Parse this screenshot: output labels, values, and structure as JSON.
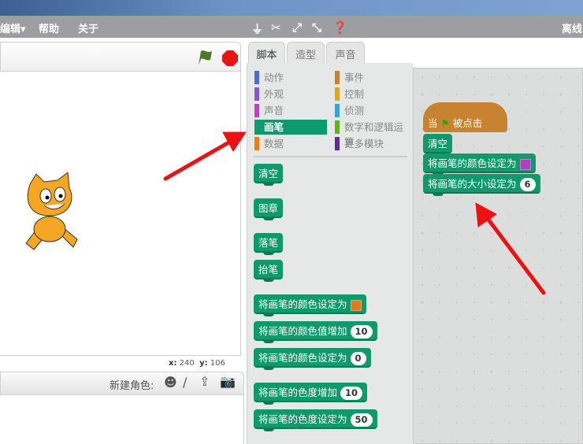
{
  "menu": {
    "edit": "编辑▾",
    "help": "帮助",
    "about": "关于",
    "offline": "离线"
  },
  "toolbar": [
    "stamp-icon",
    "scissors-icon",
    "grow-icon",
    "shrink-icon",
    "help-icon"
  ],
  "tabs": [
    "脚本",
    "造型",
    "声音"
  ],
  "categories": [
    {
      "label": "动作",
      "color": "#4a6cd4"
    },
    {
      "label": "事件",
      "color": "#c88330"
    },
    {
      "label": "外观",
      "color": "#8a55d7"
    },
    {
      "label": "控制",
      "color": "#e1a91a"
    },
    {
      "label": "声音",
      "color": "#bb42c3"
    },
    {
      "label": "侦测",
      "color": "#2ca5e2"
    },
    {
      "label": "画笔",
      "color": "#0e9a6c",
      "selected": true
    },
    {
      "label": "数字和逻辑运算",
      "color": "#5cb712"
    },
    {
      "label": "数据",
      "color": "#ee7d16"
    },
    {
      "label": "更多模块",
      "color": "#632d99"
    }
  ],
  "palette_blocks": [
    {
      "label": "清空"
    },
    {
      "label": "图章"
    },
    {
      "label": "落笔"
    },
    {
      "label": "抬笔"
    },
    {
      "label": "将画笔的颜色设定为",
      "swatch": "#e07a20"
    },
    {
      "label": "将画笔的颜色值增加",
      "value": "10"
    },
    {
      "label": "将画笔的颜色设定为",
      "value": "0"
    },
    {
      "label": "将画笔的色度增加",
      "value": "10"
    },
    {
      "label": "将画笔的色度设定为",
      "value": "50"
    }
  ],
  "script": {
    "hat": {
      "prefix": "当",
      "suffix": "被点击"
    },
    "blocks": [
      {
        "label": "清空"
      },
      {
        "label": "将画笔的颜色设定为",
        "swatch": "#b040c0"
      },
      {
        "label": "将画笔的大小设定为",
        "value": "6"
      }
    ]
  },
  "coords": {
    "x_label": "x:",
    "x": "240",
    "y_label": "y:",
    "y": "106"
  },
  "sprites": {
    "new_sprite_label": "新建角色:"
  },
  "colors": {
    "pen": "#0f9a6b",
    "events": "#c88330",
    "arrow": "#ee1111"
  }
}
